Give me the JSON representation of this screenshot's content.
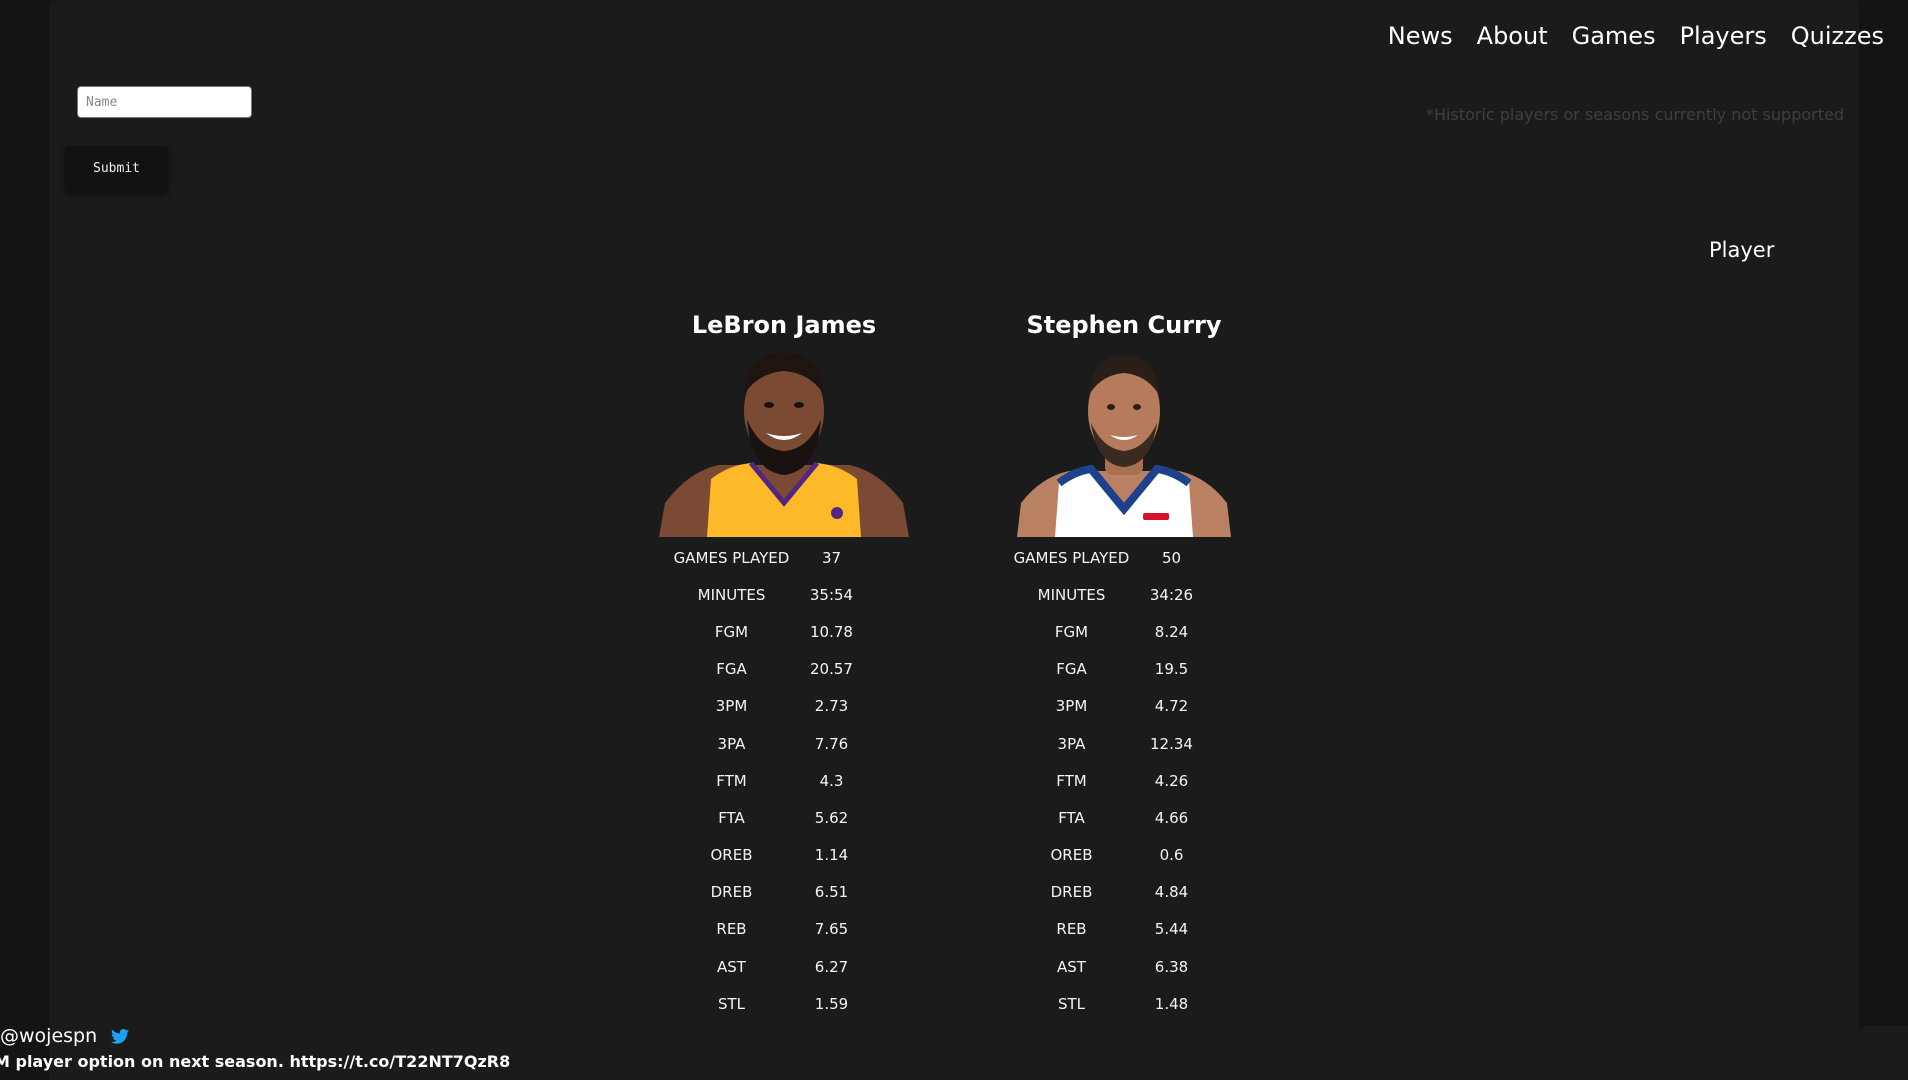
{
  "nav": {
    "items": [
      "News",
      "About",
      "Games",
      "Players",
      "Quizzes"
    ]
  },
  "search": {
    "placeholder": "Name",
    "submit_label": "Submit"
  },
  "notice": "*Historic players or seasons currently not supported",
  "toggle_label": "Player",
  "players": [
    {
      "name": "LeBron James",
      "jersey_color": "#fdb927",
      "stats": [
        {
          "label": "GAMES PLAYED",
          "value": "37"
        },
        {
          "label": "MINUTES",
          "value": "35:54"
        },
        {
          "label": "FGM",
          "value": "10.78"
        },
        {
          "label": "FGA",
          "value": "20.57"
        },
        {
          "label": "3PM",
          "value": "2.73"
        },
        {
          "label": "3PA",
          "value": "7.76"
        },
        {
          "label": "FTM",
          "value": "4.3"
        },
        {
          "label": "FTA",
          "value": "5.62"
        },
        {
          "label": "OREB",
          "value": "1.14"
        },
        {
          "label": "DREB",
          "value": "6.51"
        },
        {
          "label": "REB",
          "value": "7.65"
        },
        {
          "label": "AST",
          "value": "6.27"
        },
        {
          "label": "STL",
          "value": "1.59"
        }
      ]
    },
    {
      "name": "Stephen Curry",
      "jersey_color": "#1d428a",
      "stats": [
        {
          "label": "GAMES PLAYED",
          "value": "50"
        },
        {
          "label": "MINUTES",
          "value": "34:26"
        },
        {
          "label": "FGM",
          "value": "8.24"
        },
        {
          "label": "FGA",
          "value": "19.5"
        },
        {
          "label": "3PM",
          "value": "4.72"
        },
        {
          "label": "3PA",
          "value": "12.34"
        },
        {
          "label": "FTM",
          "value": "4.26"
        },
        {
          "label": "FTA",
          "value": "4.66"
        },
        {
          "label": "OREB",
          "value": "0.6"
        },
        {
          "label": "DREB",
          "value": "4.84"
        },
        {
          "label": "REB",
          "value": "5.44"
        },
        {
          "label": "AST",
          "value": "6.38"
        },
        {
          "label": "STL",
          "value": "1.48"
        }
      ]
    }
  ],
  "tweet": {
    "handle": "@wojespn",
    "text": "M player option on next season. https://t.co/T22NT7QzR8",
    "icon": "twitter-bird-icon",
    "icon_color": "#1da1f2"
  }
}
